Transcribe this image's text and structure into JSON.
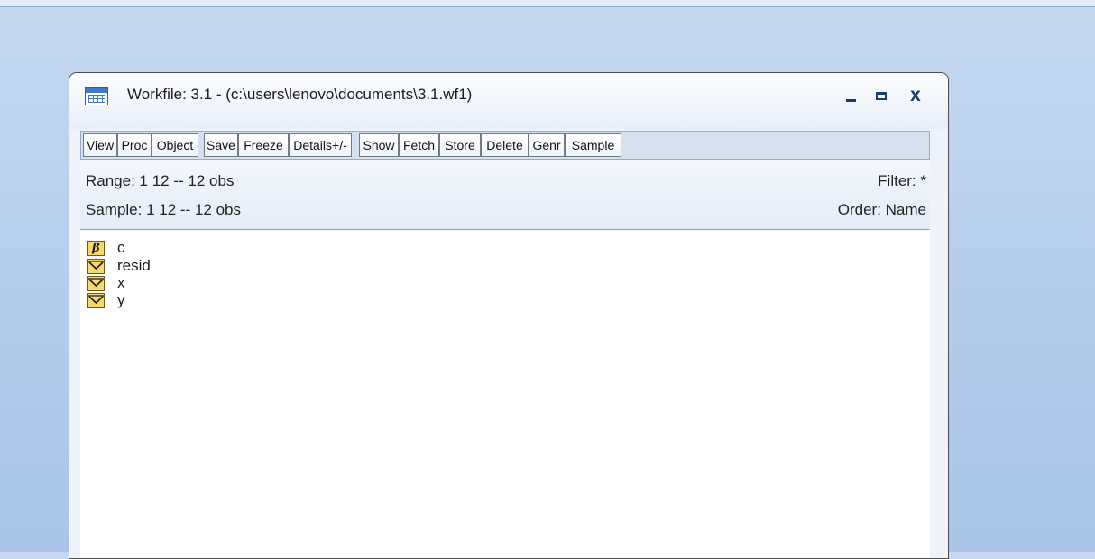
{
  "window": {
    "title": "Workfile: 3.1 - (c:\\users\\lenovo\\documents\\3.1.wf1)",
    "minimize_label": "_",
    "close_label": "x"
  },
  "toolbar": {
    "buttons": [
      "View",
      "Proc",
      "Object",
      "Save",
      "Freeze",
      "Details+/-",
      "Show",
      "Fetch",
      "Store",
      "Delete",
      "Genr",
      "Sample"
    ]
  },
  "info": {
    "range": "Range:  1 12  --  12 obs",
    "sample": "Sample: 1 12  --  12 obs",
    "filter": "Filter: *",
    "order": "Order: Name"
  },
  "objects": [
    {
      "name": "c",
      "icon": "coefficient-icon"
    },
    {
      "name": "resid",
      "icon": "series-icon"
    },
    {
      "name": "x",
      "icon": "series-icon"
    },
    {
      "name": "y",
      "icon": "series-icon"
    }
  ],
  "colors": {
    "object_icon": "#f6d86d",
    "desktop": "#b8cfec"
  }
}
